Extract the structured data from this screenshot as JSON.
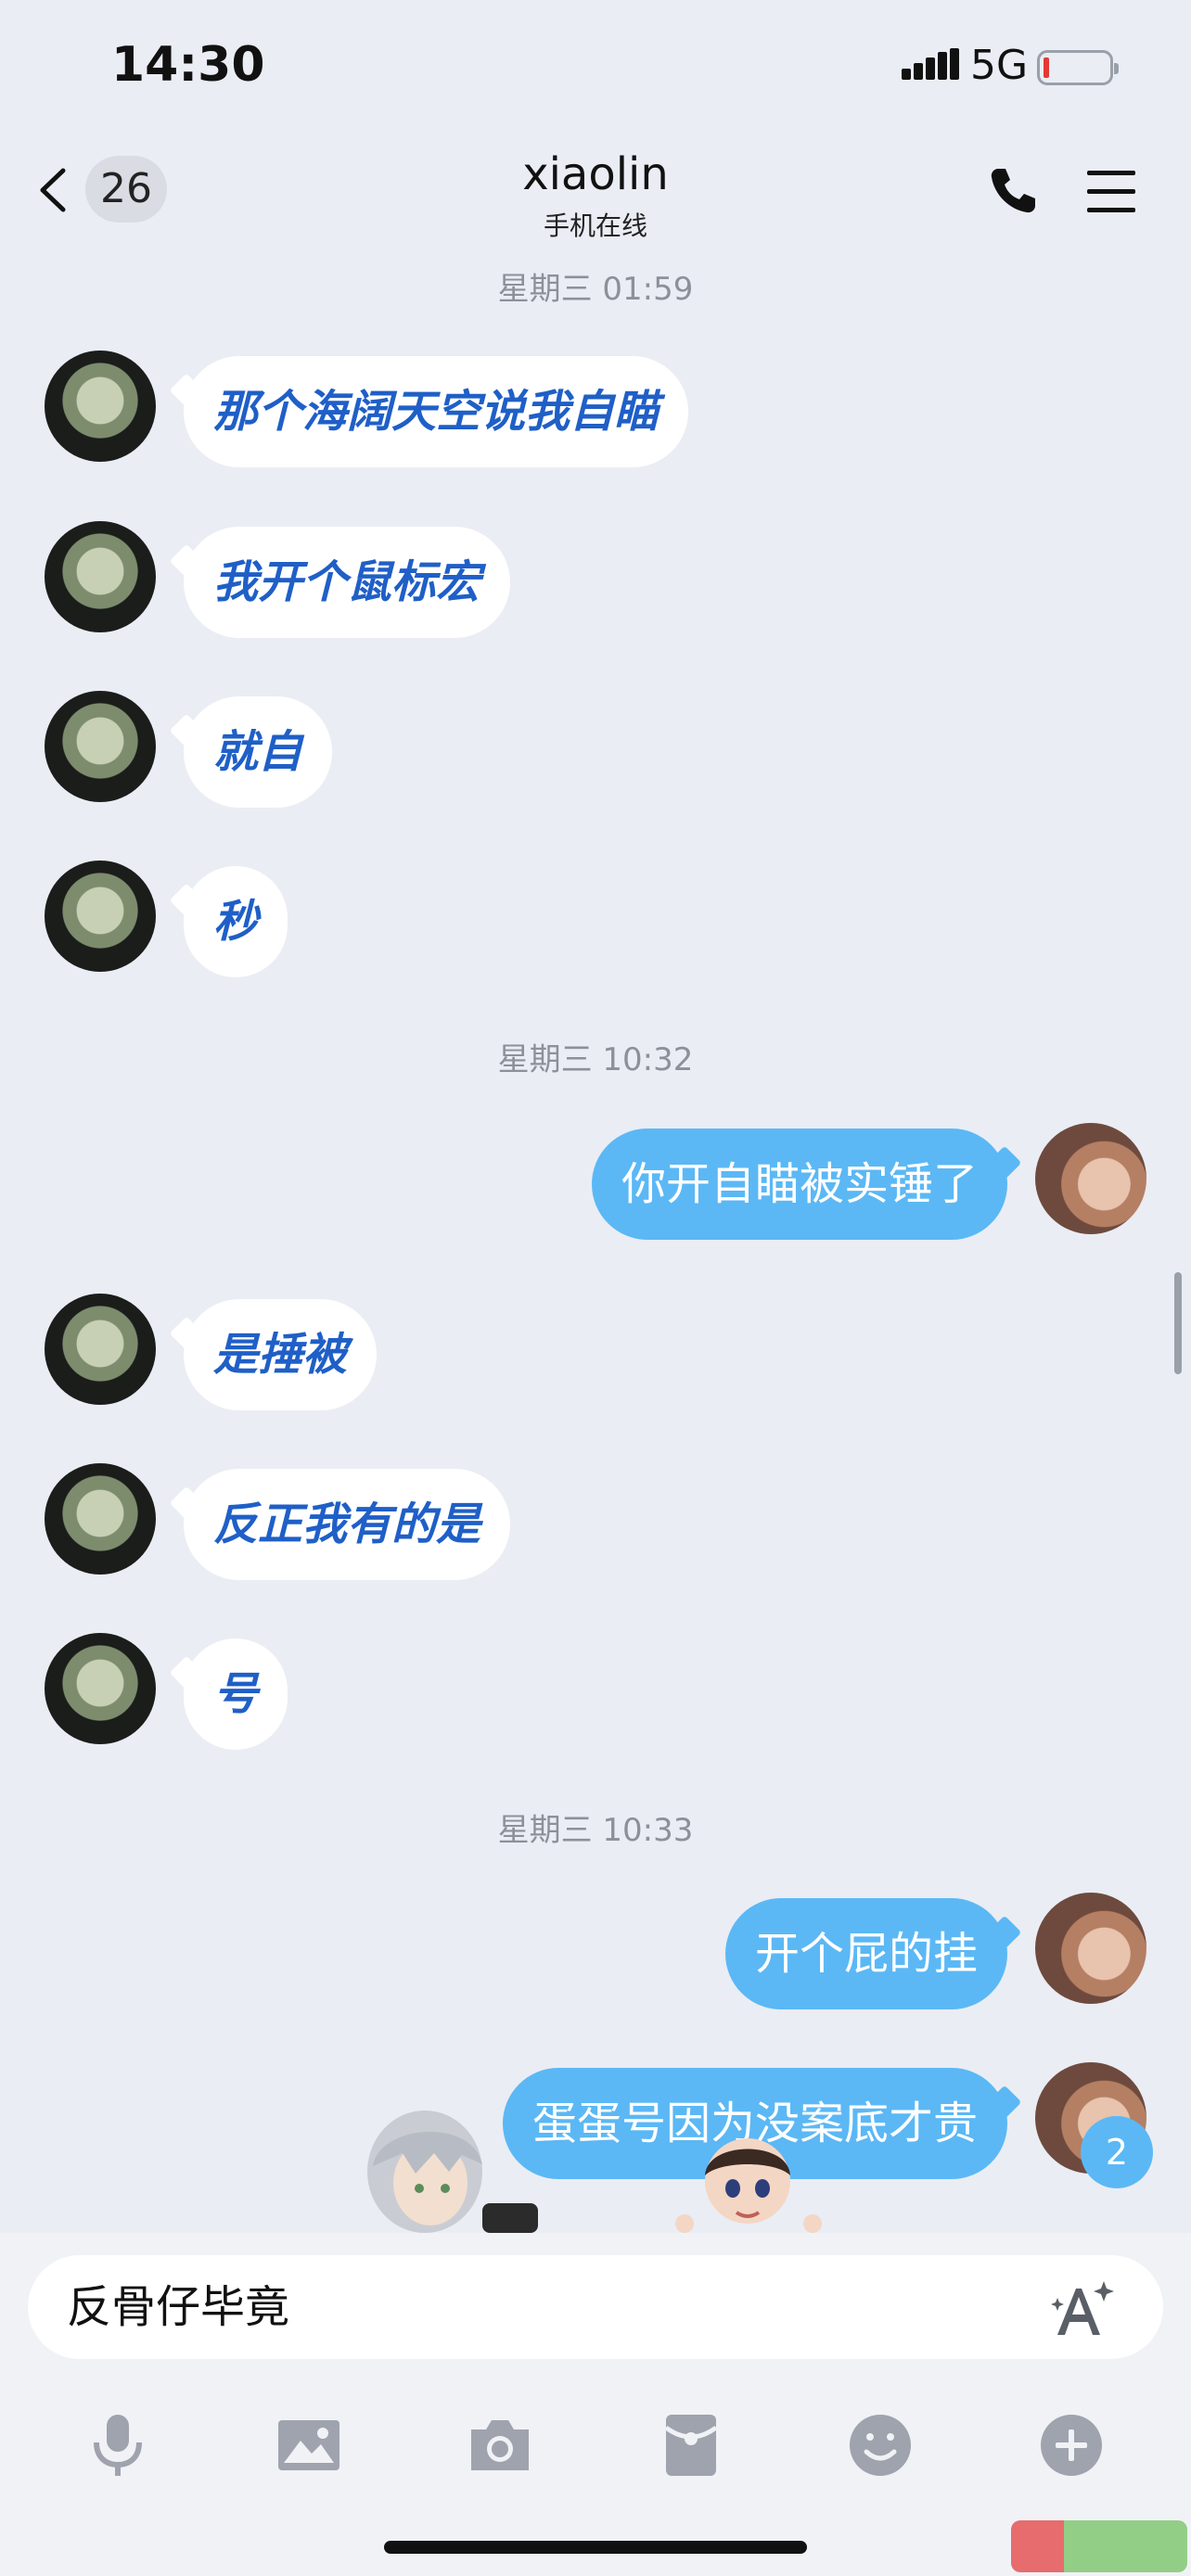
{
  "status_bar": {
    "time": "14:30",
    "network": "5G"
  },
  "nav": {
    "unread_count": "26",
    "title": "xiaolin",
    "subtitle": "手机在线"
  },
  "timestamps": [
    "星期三 01:59",
    "星期三 10:32",
    "星期三 10:33"
  ],
  "messages": {
    "m1": "那个海阔天空说我自瞄",
    "m2": "我开个鼠标宏",
    "m3": "就自",
    "m4": "秒",
    "m5": "你开自瞄被实锤了",
    "m6": "是捶被",
    "m7": "反正我有的是",
    "m8": "号",
    "m9": "开个屁的挂",
    "m10": "蛋蛋号因为没案底才贵"
  },
  "new_message_badge": "2",
  "input": {
    "value": "反骨仔毕竟"
  },
  "toolbar": {
    "items": [
      "microphone-icon",
      "image-icon",
      "camera-icon",
      "red-packet-icon",
      "emoji-icon",
      "plus-icon"
    ]
  },
  "colors": {
    "background": "#eaedf4",
    "incoming_bubble": "#ffffff",
    "incoming_text": "#1f5fc7",
    "outgoing_bubble": "#5bb8f5",
    "outgoing_text": "#ffffff",
    "timestamp_text": "#8c9099",
    "toolbar_icon": "#9ea3ad"
  }
}
